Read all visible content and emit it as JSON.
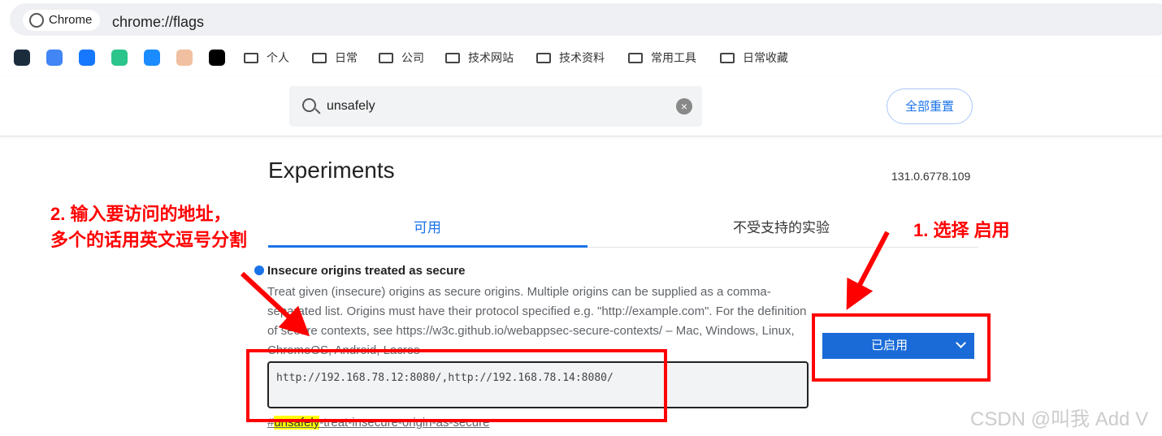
{
  "browser": {
    "chip": "Chrome",
    "url": "chrome://flags"
  },
  "bookmarks": {
    "icons": [
      "deepl-icon",
      "google-translate-icon",
      "blue-app-icon",
      "green-app-icon",
      "flame-app-icon",
      "avatar-icon",
      "k-app-icon"
    ],
    "icon_colors": [
      "#1b2c3d",
      "#4285f4",
      "#1677ff",
      "#2bc48a",
      "#1a8cff",
      "#f0c0a0",
      "#000000"
    ],
    "folders": [
      "个人",
      "日常",
      "公司",
      "技术网站",
      "技术资料",
      "常用工具",
      "日常收藏"
    ]
  },
  "search": {
    "value": "unsafely"
  },
  "reset_label": "全部重置",
  "title": "Experiments",
  "version": "131.0.6778.109",
  "tabs": [
    "可用",
    "不受支持的实验"
  ],
  "flag": {
    "name": "Insecure origins treated as secure",
    "description": "Treat given (insecure) origins as secure origins. Multiple origins can be supplied as a comma-separated list. Origins must have their protocol specified e.g. \"http://example.com\". For the definition of secure contexts, see https://w3c.github.io/webappsec-secure-contexts/ – Mac, Windows, Linux, ChromeOS, Android, Lacros",
    "value": "http://192.168.78.12:8080/,http://192.168.78.14:8080/",
    "link_highlight": "unsafely",
    "link_rest": "-treat-insecure-origin-as-secure",
    "hash": "#",
    "select": "已启用"
  },
  "annotations": {
    "step2_line1": "2. 输入要访问的地址，",
    "step2_line2": "多个的话用英文逗号分割",
    "step1": "1. 选择 启用"
  },
  "watermark": "CSDN @叫我 Add V"
}
